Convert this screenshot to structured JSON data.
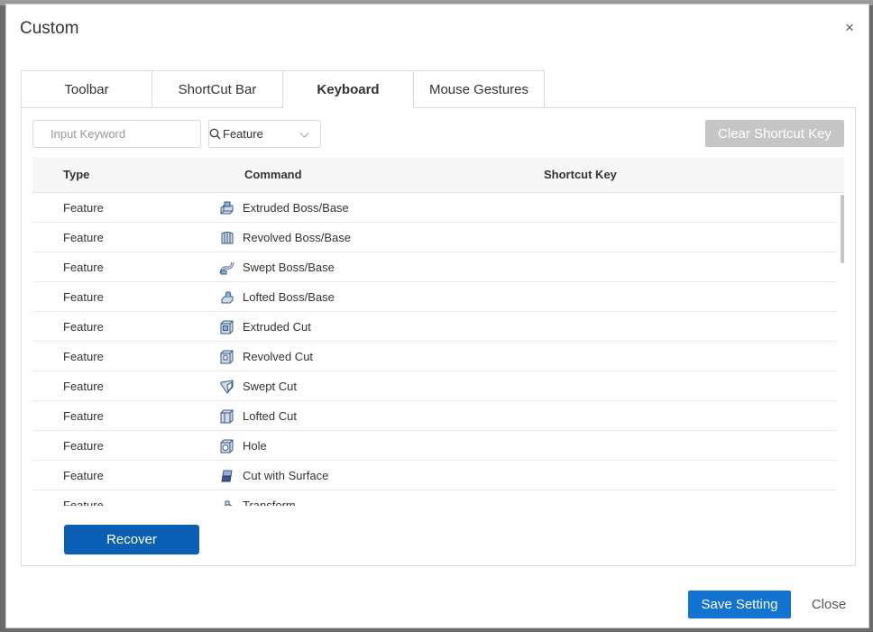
{
  "dialog": {
    "title": "Custom"
  },
  "tabs": [
    {
      "label": "Toolbar",
      "active": false
    },
    {
      "label": "ShortCut Bar",
      "active": false
    },
    {
      "label": "Keyboard",
      "active": true
    },
    {
      "label": "Mouse Gestures",
      "active": false
    }
  ],
  "search": {
    "placeholder": "Input Keyword",
    "value": ""
  },
  "filter": {
    "selected": "Feature"
  },
  "clear_button": "Clear Shortcut Key",
  "table": {
    "headers": {
      "type": "Type",
      "command": "Command",
      "shortcut": "Shortcut Key"
    },
    "rows": [
      {
        "type": "Feature",
        "command": "Extruded Boss/Base",
        "icon": "extruded-boss-icon"
      },
      {
        "type": "Feature",
        "command": "Revolved Boss/Base",
        "icon": "revolved-boss-icon"
      },
      {
        "type": "Feature",
        "command": "Swept Boss/Base",
        "icon": "swept-boss-icon"
      },
      {
        "type": "Feature",
        "command": "Lofted Boss/Base",
        "icon": "lofted-boss-icon"
      },
      {
        "type": "Feature",
        "command": "Extruded Cut",
        "icon": "extruded-cut-icon"
      },
      {
        "type": "Feature",
        "command": "Revolved Cut",
        "icon": "revolved-cut-icon"
      },
      {
        "type": "Feature",
        "command": "Swept Cut",
        "icon": "swept-cut-icon"
      },
      {
        "type": "Feature",
        "command": "Lofted Cut",
        "icon": "lofted-cut-icon"
      },
      {
        "type": "Feature",
        "command": "Hole",
        "icon": "hole-icon"
      },
      {
        "type": "Feature",
        "command": "Cut with Surface",
        "icon": "cut-with-surface-icon"
      },
      {
        "type": "Feature",
        "command": "Transform",
        "icon": "transform-icon"
      }
    ]
  },
  "recover_button": "Recover",
  "footer": {
    "save_label": "Save Setting",
    "close_label": "Close"
  },
  "colors": {
    "primary": "#0b60b6",
    "save": "#1273d0",
    "disabled": "#c6c6c6"
  }
}
